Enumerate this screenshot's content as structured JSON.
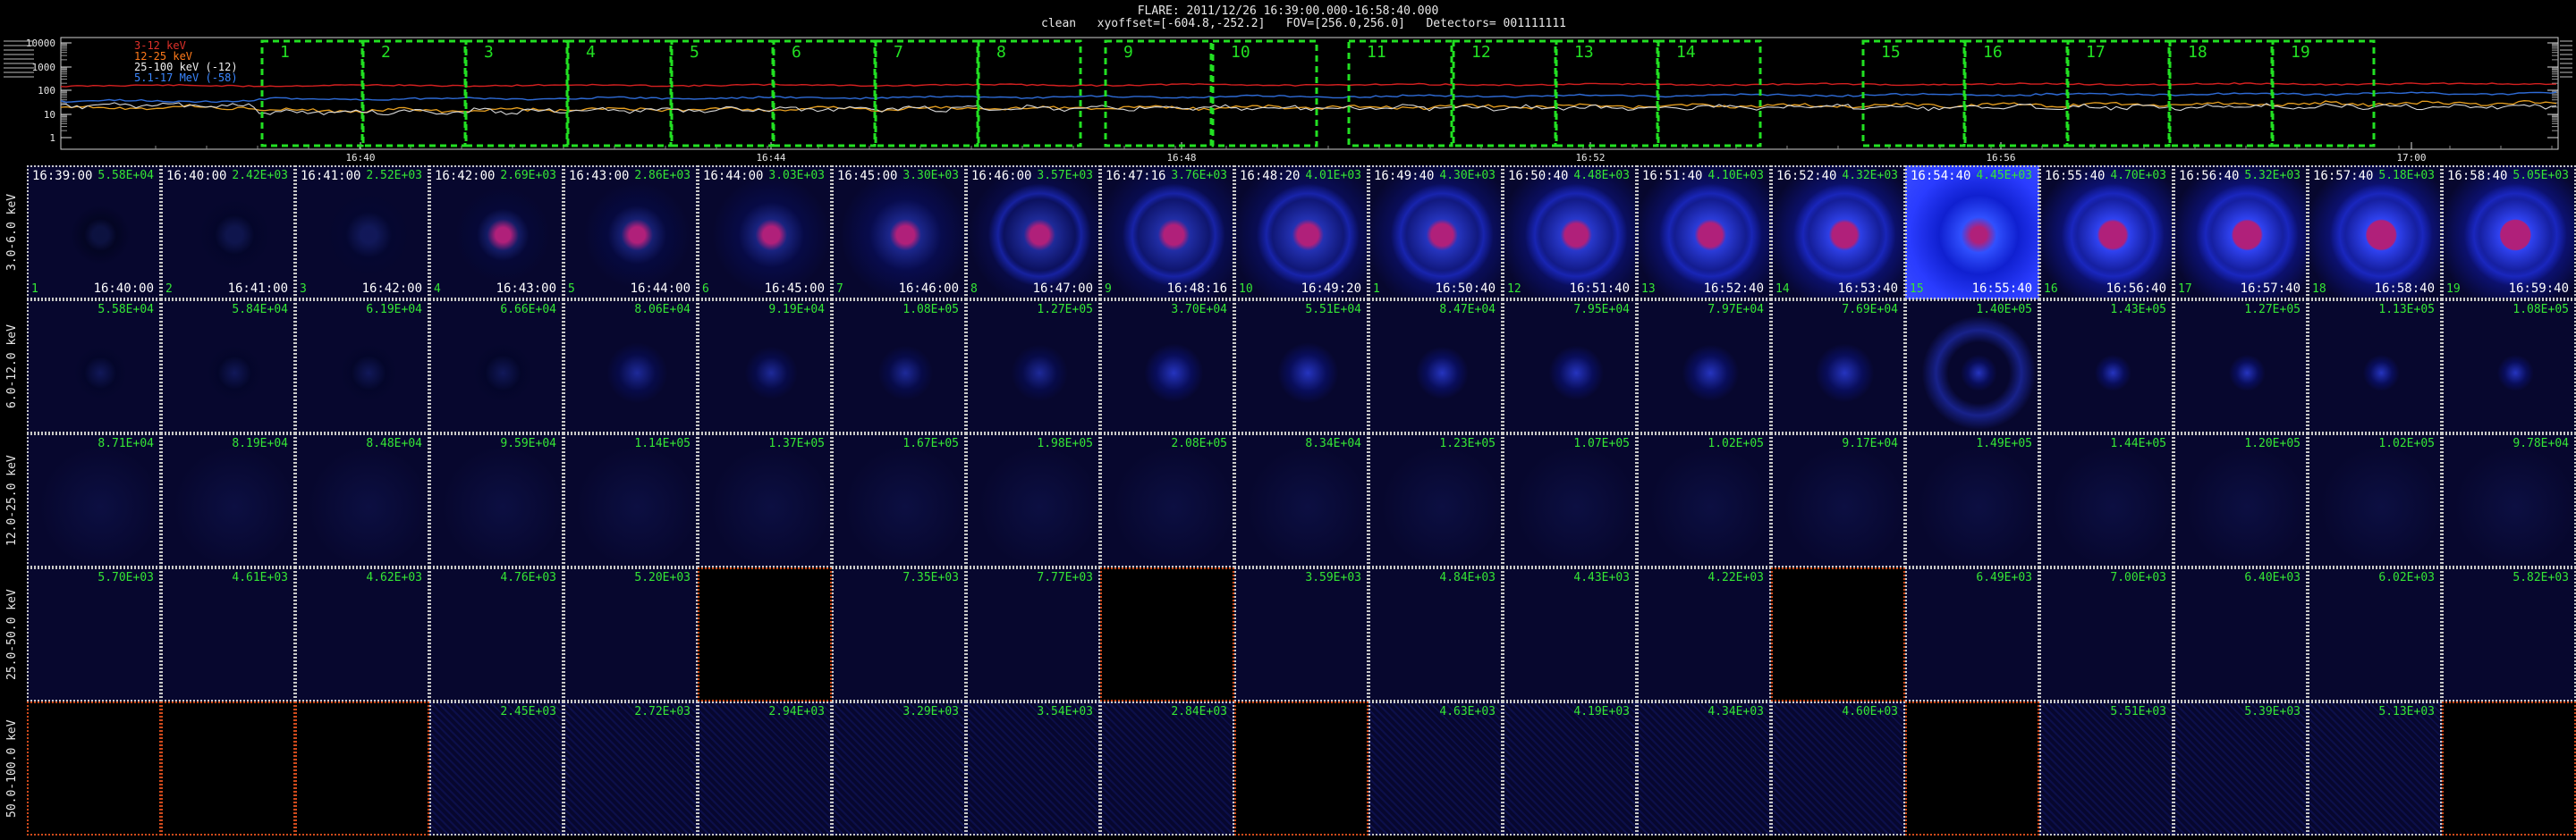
{
  "header": {
    "title": "FLARE: 2011/12/26 16:39:00.000-16:58:40.000",
    "line2": "clean   xyoffset=[-604.8,-252.2]   FOV=[256.0,256.0]   Detectors= 001111111"
  },
  "lightcurve": {
    "y_tick_labels": [
      "10000",
      "1000",
      "100",
      "10",
      "1"
    ],
    "x_tick_labels": [
      "16:40",
      "16:44",
      "16:48",
      "16:52",
      "16:56",
      "17:00"
    ],
    "legend": [
      {
        "label": "3-12 keV",
        "color": "#e0302a"
      },
      {
        "label": "12-25 keV",
        "color": "#ff7a1a"
      },
      {
        "label": "25-100 keV (-12)",
        "color": "#f0f0f0"
      },
      {
        "label": "5.1-17 MeV (-58)",
        "color": "#3a86ff"
      }
    ],
    "series_colors": {
      "red": "#d52020",
      "blue": "#2e6bd6",
      "orange": "#e8a020",
      "white": "#d8d8d8"
    },
    "interval_color": "#22e022",
    "interval_labels": [
      "1",
      "2",
      "3",
      "4",
      "5",
      "6",
      "7",
      "8",
      "9",
      "10",
      "11",
      "12",
      "13",
      "14",
      "15",
      "16",
      "17",
      "18",
      "19"
    ]
  },
  "image_cube": {
    "energy_bands": [
      "3.0-6.0 keV",
      "6.0-12.0 keV",
      "12.0-25.0 keV",
      "25.0-50.0 keV",
      "50.0-100.0 keV"
    ],
    "start_times": [
      "16:39:00",
      "16:40:00",
      "16:41:00",
      "16:42:00",
      "16:43:00",
      "16:44:00",
      "16:45:00",
      "16:46:00",
      "16:47:16",
      "16:48:20",
      "16:49:40",
      "16:50:40",
      "16:51:40",
      "16:52:40",
      "16:54:40",
      "16:55:40",
      "16:56:40",
      "16:57:40",
      "16:58:40"
    ],
    "end_times": [
      "16:40:00",
      "16:41:00",
      "16:42:00",
      "16:43:00",
      "16:44:00",
      "16:45:00",
      "16:46:00",
      "16:47:00",
      "16:48:16",
      "16:49:20",
      "16:50:40",
      "16:51:40",
      "16:52:40",
      "16:53:40",
      "16:55:40",
      "16:56:40",
      "16:57:40",
      "16:58:40",
      "16:59:40"
    ],
    "panel_index_labels": [
      "1",
      "2",
      "3",
      "4",
      "5",
      "6",
      "7",
      "8",
      "9",
      "10",
      "1",
      "12",
      "13",
      "14",
      "15",
      "16",
      "17",
      "18",
      "19"
    ],
    "flux_labels": [
      [
        "5.58E+04",
        "2.42E+03",
        "2.52E+03",
        "2.69E+03",
        "2.86E+03",
        "3.03E+03",
        "3.30E+03",
        "3.57E+03",
        "3.76E+03",
        "4.01E+03",
        "4.30E+03",
        "4.48E+03",
        "4.10E+03",
        "4.32E+03",
        "4.45E+03",
        "4.70E+03",
        "5.32E+03",
        "5.18E+03",
        "5.05E+03"
      ],
      [
        "5.58E+04",
        "5.84E+04",
        "6.19E+04",
        "6.66E+04",
        "8.06E+04",
        "9.19E+04",
        "1.08E+05",
        "1.27E+05",
        "3.70E+04",
        "5.51E+04",
        "8.47E+04",
        "7.95E+04",
        "7.97E+04",
        "7.69E+04",
        "1.40E+05",
        "1.43E+05",
        "1.27E+05",
        "1.13E+05",
        "1.08E+05"
      ],
      [
        "8.71E+04",
        "8.19E+04",
        "8.48E+04",
        "9.59E+04",
        "1.14E+05",
        "1.37E+05",
        "1.67E+05",
        "1.98E+05",
        "2.08E+05",
        "8.34E+04",
        "1.23E+05",
        "1.07E+05",
        "1.02E+05",
        "9.17E+04",
        "1.49E+05",
        "1.44E+05",
        "1.20E+05",
        "1.02E+05",
        "9.78E+04"
      ],
      [
        "5.70E+03",
        "4.61E+03",
        "4.62E+03",
        "4.76E+03",
        "5.20E+03",
        "",
        "7.35E+03",
        "7.77E+03",
        "",
        "3.59E+03",
        "4.84E+03",
        "4.43E+03",
        "4.22E+03",
        "",
        "6.49E+03",
        "7.00E+03",
        "6.40E+03",
        "6.02E+03",
        "5.82E+03"
      ],
      [
        "",
        "",
        "",
        "2.45E+03",
        "2.72E+03",
        "2.94E+03",
        "3.29E+03",
        "3.54E+03",
        "2.84E+03",
        "",
        "4.63E+03",
        "4.19E+03",
        "4.34E+03",
        "4.60E+03",
        "",
        "5.51E+03",
        "5.39E+03",
        "5.13E+03",
        ""
      ]
    ],
    "blank_panels": [
      [],
      [],
      [],
      [
        6,
        9,
        14
      ],
      [
        1,
        2,
        3,
        10,
        15,
        19
      ]
    ],
    "colormap": {
      "background": "#07072e",
      "source": "#2233ff",
      "core": "#b0207a"
    }
  }
}
